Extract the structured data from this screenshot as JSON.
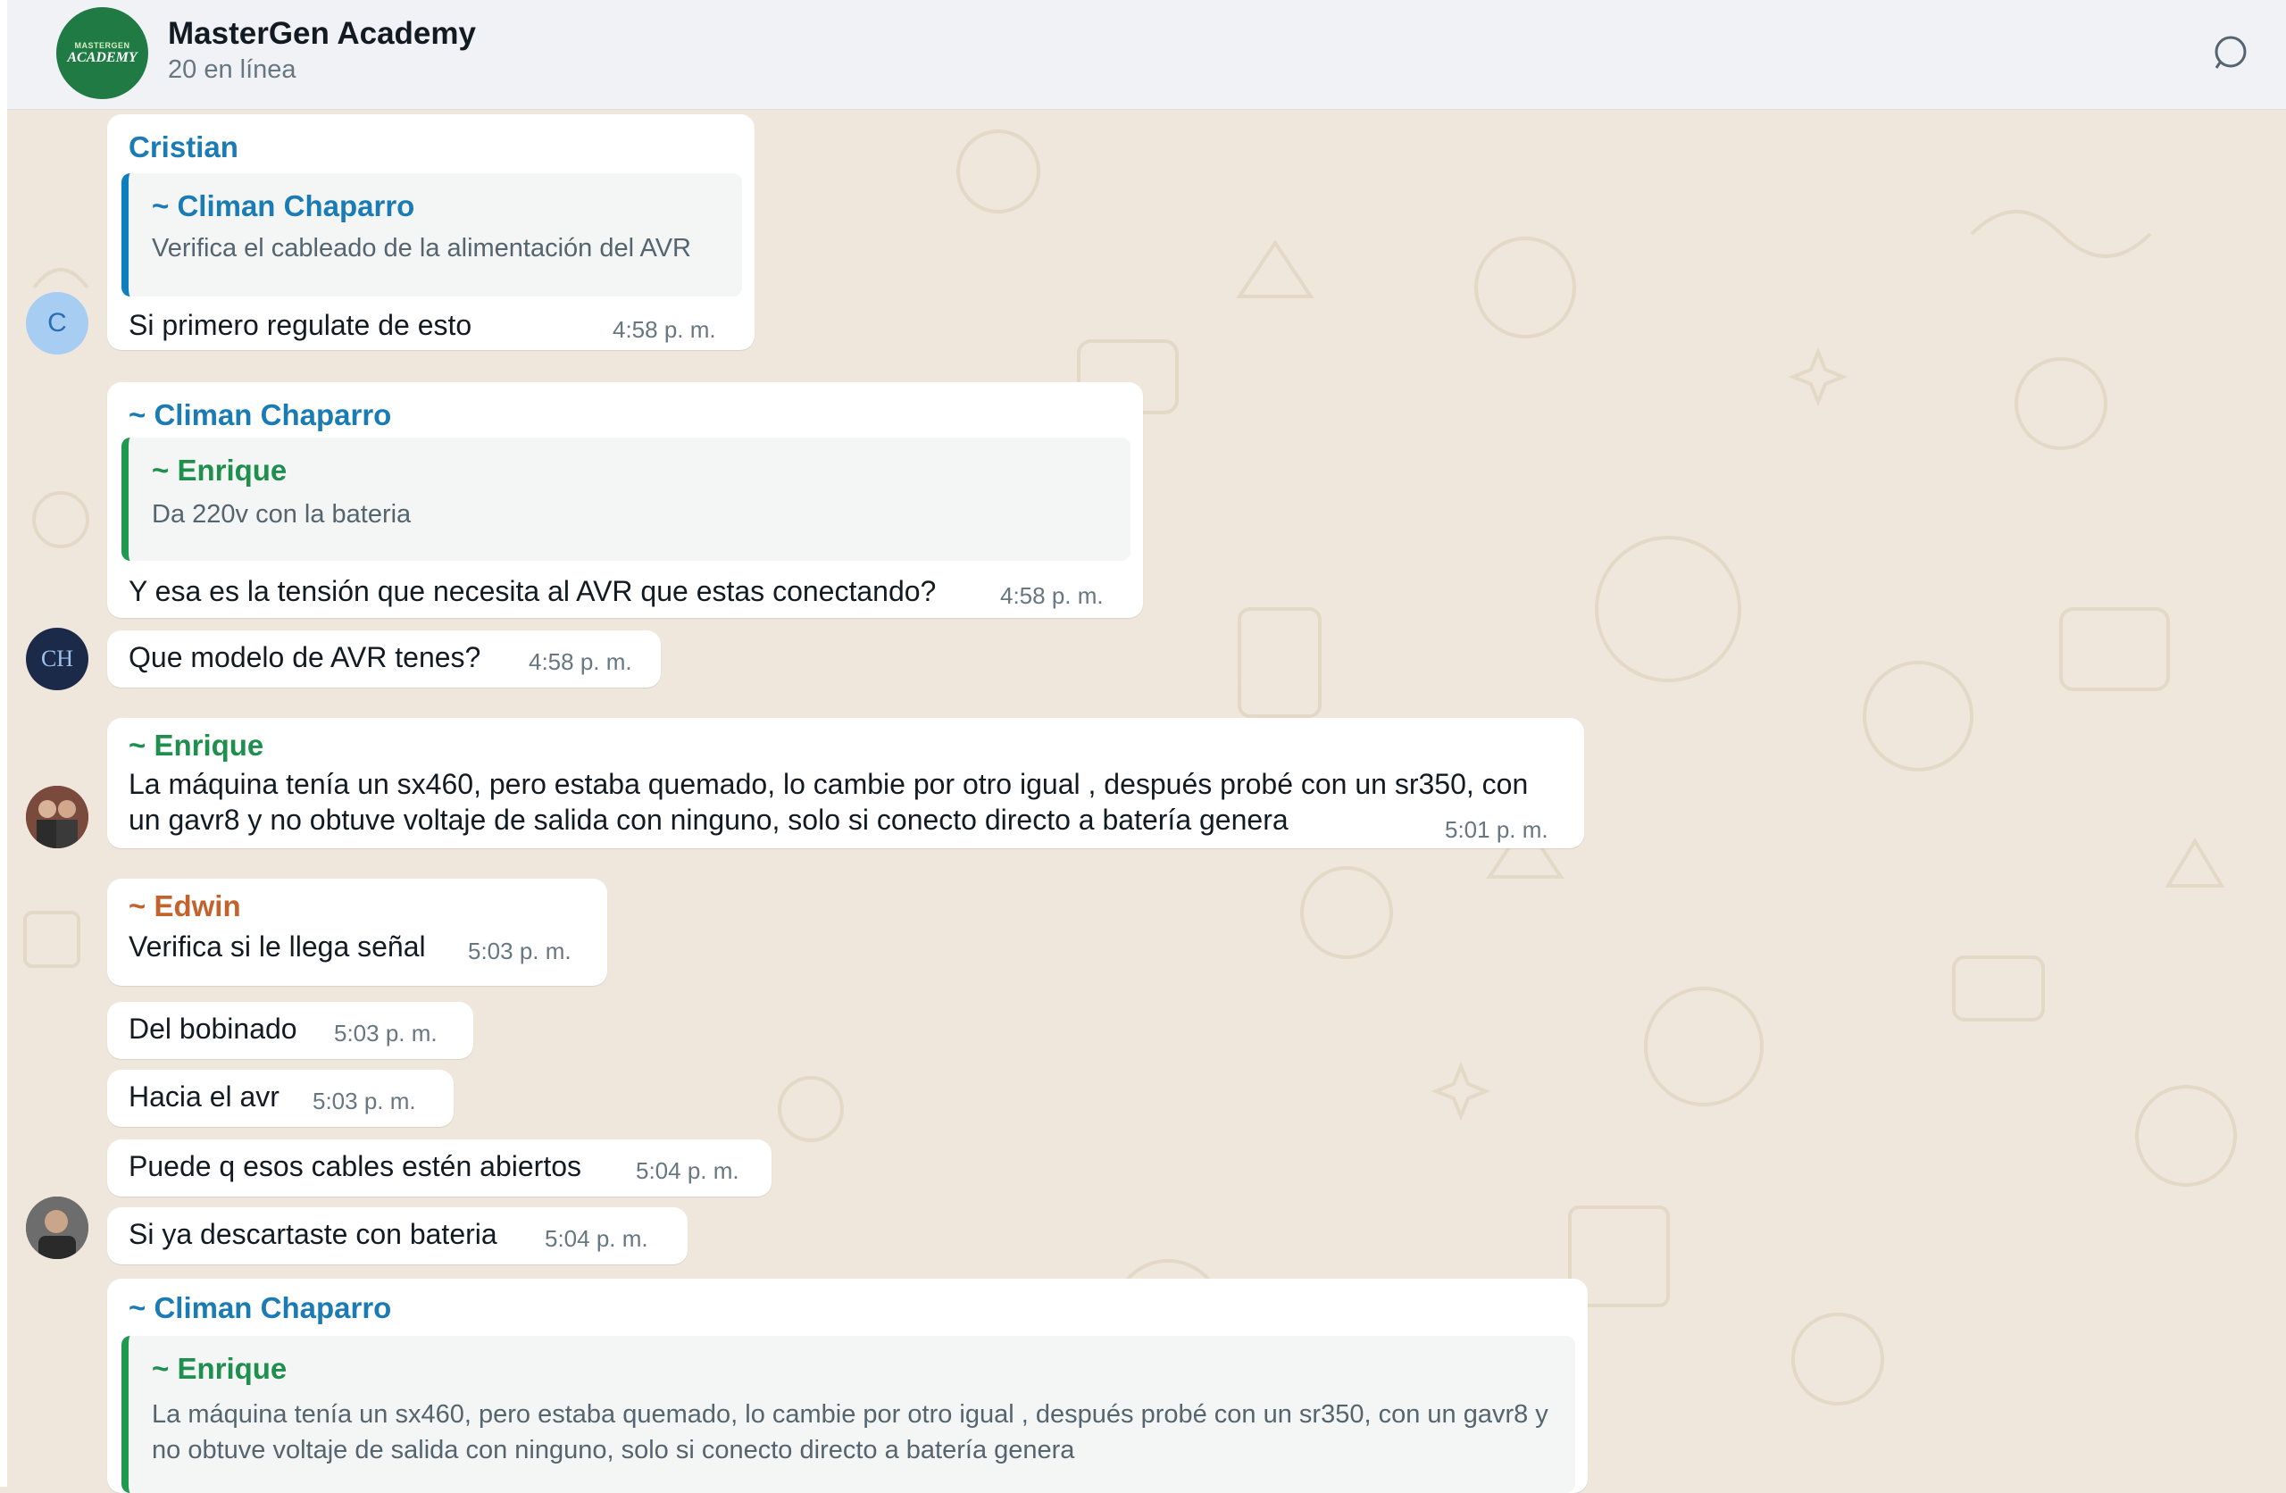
{
  "header": {
    "avatar_line1": "MASTERGEN",
    "avatar_line2": "ACADEMY",
    "title": "MasterGen Academy",
    "subtitle": "20 en línea"
  },
  "colors": {
    "sender_blue": "#1a7bb5",
    "sender_green": "#1f8f4e",
    "sender_orange": "#c4622d",
    "chat_bg": "#efe7dc"
  },
  "messages": [
    {
      "sender": "Cristian",
      "quote_sender": "~ Climan Chaparro",
      "quote_text": "Verifica el cableado de la alimentación del AVR",
      "text": "Si primero regulate de esto",
      "time": "4:58 p. m.",
      "avatar_letter": "C"
    },
    {
      "sender": "~ Climan Chaparro",
      "quote_sender": "~ Enrique",
      "quote_text": "Da 220v con la bateria",
      "text": "Y esa es la tensión que necesita al AVR que estas conectando?",
      "time": "4:58 p. m."
    },
    {
      "text": "Que modelo de AVR tenes?",
      "time": "4:58 p. m.",
      "avatar_letter": "CH"
    },
    {
      "sender": "~ Enrique",
      "text": "La máquina tenía un sx460, pero estaba quemado, lo cambie por otro igual , después probé con un sr350, con un gavr8 y no obtuve voltaje de salida con ninguno, solo si conecto directo a batería genera",
      "time": "5:01 p. m."
    },
    {
      "sender": "~ Edwin",
      "text": "Verifica si le llega señal",
      "time": "5:03 p. m."
    },
    {
      "text": "Del bobinado",
      "time": "5:03 p. m."
    },
    {
      "text": "Hacia el avr",
      "time": "5:03 p. m."
    },
    {
      "text": "Puede q esos cables estén abiertos",
      "time": "5:04 p. m."
    },
    {
      "text": "Si ya descartaste con bateria",
      "time": "5:04 p. m."
    },
    {
      "sender": "~ Climan Chaparro",
      "quote_sender": "~ Enrique",
      "quote_text": "La máquina tenía un sx460, pero estaba quemado, lo cambie por otro igual , después probé con un sr350, con un gavr8 y no obtuve voltaje de salida con ninguno, solo si conecto directo a batería genera"
    }
  ]
}
